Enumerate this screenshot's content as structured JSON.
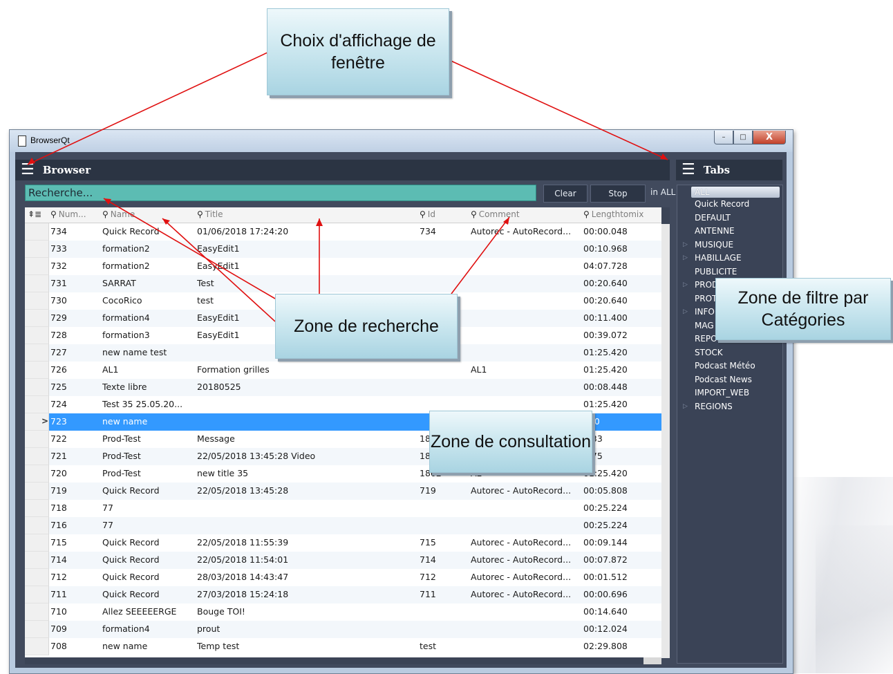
{
  "window": {
    "title": "BrowserQt",
    "controls": {
      "minimize": "–",
      "maximize": "□",
      "close": "X"
    }
  },
  "browser_panel": {
    "hamburger": "☰",
    "title": "Browser",
    "search": {
      "value": "Recherche..."
    },
    "clear_label": "Clear",
    "stop_label": "Stop",
    "scope_label": "in ALL"
  },
  "table": {
    "columns": [
      "Num...",
      "Name",
      "Title",
      "Id",
      "Comment",
      "Lengthtomix"
    ],
    "rows": [
      [
        "734",
        "Quick Record",
        "01/06/2018 17:24:20",
        "734",
        "Autorec - AutoRecord...",
        "00:00.048"
      ],
      [
        "733",
        "formation2",
        "EasyEdit1",
        "",
        "",
        "00:10.968"
      ],
      [
        "732",
        "formation2",
        "EasyEdit1",
        "",
        "",
        "04:07.728"
      ],
      [
        "731",
        "SARRAT",
        "Test",
        "",
        "",
        "00:20.640"
      ],
      [
        "730",
        "CocoRico",
        "test",
        "",
        "",
        "00:20.640"
      ],
      [
        "729",
        "formation4",
        "EasyEdit1",
        "",
        "",
        "00:11.400"
      ],
      [
        "728",
        "formation3",
        "EasyEdit1",
        "",
        "",
        "00:39.072"
      ],
      [
        "727",
        "new name test",
        "",
        "",
        "",
        "01:25.420"
      ],
      [
        "726",
        "AL1",
        " Formation grilles",
        "",
        "AL1",
        "01:25.420"
      ],
      [
        "725",
        "Texte libre",
        "20180525",
        "",
        "",
        "00:08.448"
      ],
      [
        "724",
        "Test 35 25.05.20...",
        "",
        "",
        "",
        "01:25.420"
      ],
      [
        "723",
        "new name",
        "",
        "",
        "",
        "420"
      ],
      [
        "722",
        "Prod-Test",
        "Message",
        "18",
        "",
        ".133"
      ],
      [
        "721",
        "Prod-Test",
        "22/05/2018 13:45:28 Video",
        "18",
        "",
        ".975"
      ],
      [
        "720",
        "Prod-Test",
        "new title 35",
        "1802",
        "AL",
        "01:25.420"
      ],
      [
        "719",
        "Quick Record",
        "22/05/2018 13:45:28",
        "719",
        "Autorec - AutoRecord...",
        "00:05.808"
      ],
      [
        "718",
        "77",
        "",
        "",
        "",
        "00:25.224"
      ],
      [
        "716",
        "77",
        "",
        "",
        "",
        "00:25.224"
      ],
      [
        "715",
        "Quick Record",
        "22/05/2018 11:55:39",
        "715",
        "Autorec - AutoRecord...",
        "00:09.144"
      ],
      [
        "714",
        "Quick Record",
        "22/05/2018 11:54:01",
        "714",
        "Autorec - AutoRecord...",
        "00:07.872"
      ],
      [
        "712",
        "Quick Record",
        "28/03/2018 14:43:47",
        "712",
        "Autorec - AutoRecord...",
        "00:01.512"
      ],
      [
        "711",
        "Quick Record",
        "27/03/2018 15:24:18",
        "711",
        "Autorec - AutoRecord...",
        "00:00.696"
      ],
      [
        "710",
        "Allez SEEEEERGE",
        "Bouge TOI!",
        "",
        "",
        "00:14.640"
      ],
      [
        "709",
        "formation4",
        "prout",
        "",
        "",
        "00:12.024"
      ],
      [
        "708",
        "new name",
        "Temp test",
        "test",
        "",
        "02:29.808"
      ]
    ],
    "selected_index": 11,
    "selected_marker": ">"
  },
  "tabs_panel": {
    "hamburger": "☰",
    "title": "Tabs",
    "categories": [
      {
        "label": "ALL",
        "expandable": false
      },
      {
        "label": "Quick Record",
        "expandable": false
      },
      {
        "label": "DEFAULT",
        "expandable": false
      },
      {
        "label": "ANTENNE",
        "expandable": false
      },
      {
        "label": "MUSIQUE",
        "expandable": true
      },
      {
        "label": "HABILLAGE",
        "expandable": true
      },
      {
        "label": "PUBLICITE",
        "expandable": false
      },
      {
        "label": "PROD",
        "expandable": true
      },
      {
        "label": "PROT",
        "expandable": false
      },
      {
        "label": "INFO",
        "expandable": true
      },
      {
        "label": "MAG",
        "expandable": false
      },
      {
        "label": "REPONDEUR",
        "expandable": false
      },
      {
        "label": "STOCK",
        "expandable": false
      },
      {
        "label": "Podcast Météo",
        "expandable": false
      },
      {
        "label": "Podcast News",
        "expandable": false
      },
      {
        "label": "IMPORT_WEB",
        "expandable": false
      },
      {
        "label": "REGIONS",
        "expandable": true
      }
    ],
    "selected_index": 0
  },
  "annotations": {
    "window_choice": "Choix d'affichage de fenêtre",
    "search_zone": "Zone de recherche",
    "consult_zone": "Zone de consultation",
    "filter_zone": "Zone de filtre par Catégories",
    "arrow_color": "#e01010"
  },
  "colors": {
    "panel_bg": "#414a5d",
    "header_bg": "#2b3443",
    "search_bg": "#5cbcb3",
    "selection": "#3399ff"
  }
}
